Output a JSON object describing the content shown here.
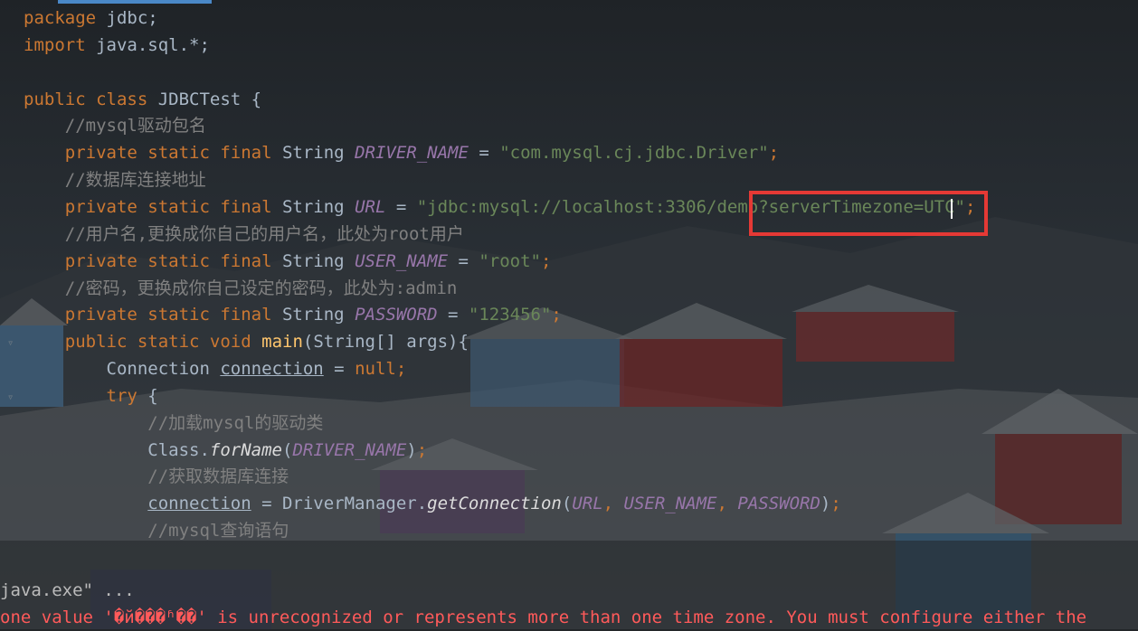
{
  "editor": {
    "lines": [
      [
        {
          "t": "package",
          "c": "kw"
        },
        {
          "t": " jdbc;",
          "c": "plain"
        }
      ],
      [
        {
          "t": "import",
          "c": "kw"
        },
        {
          "t": " java.sql.*;",
          "c": "plain"
        }
      ],
      [],
      [
        {
          "t": "public class",
          "c": "kw"
        },
        {
          "t": " JDBCTest {",
          "c": "plain"
        }
      ],
      [
        {
          "t": "    //mysql驱动包名",
          "c": "cmt"
        }
      ],
      [
        {
          "t": "    private static final",
          "c": "kw"
        },
        {
          "t": " String ",
          "c": "plain"
        },
        {
          "t": "DRIVER_NAME",
          "c": "const"
        },
        {
          "t": " = ",
          "c": "plain"
        },
        {
          "t": "\"com.mysql.cj.jdbc.Driver\"",
          "c": "str"
        },
        {
          "t": ";",
          "c": "kw"
        }
      ],
      [
        {
          "t": "    //数据库连接地址",
          "c": "cmt"
        }
      ],
      [
        {
          "t": "    private static final",
          "c": "kw"
        },
        {
          "t": " String ",
          "c": "plain"
        },
        {
          "t": "URL",
          "c": "const"
        },
        {
          "t": " = ",
          "c": "plain"
        },
        {
          "t": "\"jdbc:mysql://localhost:3306/demo?serverTimezone=UTC\"",
          "c": "str"
        },
        {
          "t": ";",
          "c": "kw"
        }
      ],
      [
        {
          "t": "    //用户名,更换成你自己的用户名，此处为root用户",
          "c": "cmt"
        }
      ],
      [
        {
          "t": "    private static final",
          "c": "kw"
        },
        {
          "t": " String ",
          "c": "plain"
        },
        {
          "t": "USER_NAME",
          "c": "const"
        },
        {
          "t": " = ",
          "c": "plain"
        },
        {
          "t": "\"root\"",
          "c": "str"
        },
        {
          "t": ";",
          "c": "kw"
        }
      ],
      [
        {
          "t": "    //密码，更换成你自己设定的密码，此处为:admin",
          "c": "cmt"
        }
      ],
      [
        {
          "t": "    private static final",
          "c": "kw"
        },
        {
          "t": " String ",
          "c": "plain"
        },
        {
          "t": "PASSWORD",
          "c": "const"
        },
        {
          "t": " = ",
          "c": "plain"
        },
        {
          "t": "\"123456\"",
          "c": "str"
        },
        {
          "t": ";",
          "c": "kw"
        }
      ],
      [
        {
          "t": "    public static void",
          "c": "kw"
        },
        {
          "t": " ",
          "c": "plain"
        },
        {
          "t": "main",
          "c": "fn"
        },
        {
          "t": "(String[] args){",
          "c": "plain"
        }
      ],
      [
        {
          "t": "        Connection ",
          "c": "plain"
        },
        {
          "t": "connection",
          "c": "local"
        },
        {
          "t": " = ",
          "c": "plain"
        },
        {
          "t": "null",
          "c": "kw"
        },
        {
          "t": ";",
          "c": "kw"
        }
      ],
      [
        {
          "t": "        try",
          "c": "kw"
        },
        {
          "t": " {",
          "c": "plain"
        }
      ],
      [
        {
          "t": "            //加载mysql的驱动类",
          "c": "cmt"
        }
      ],
      [
        {
          "t": "            Class.",
          "c": "plain"
        },
        {
          "t": "forName",
          "c": "call"
        },
        {
          "t": "(",
          "c": "plain"
        },
        {
          "t": "DRIVER_NAME",
          "c": "const"
        },
        {
          "t": ")",
          "c": "plain"
        },
        {
          "t": ";",
          "c": "kw"
        }
      ],
      [
        {
          "t": "            //获取数据库连接",
          "c": "cmt"
        }
      ],
      [
        {
          "t": "            ",
          "c": "plain"
        },
        {
          "t": "connection",
          "c": "local"
        },
        {
          "t": " = DriverManager.",
          "c": "plain"
        },
        {
          "t": "getConnection",
          "c": "call"
        },
        {
          "t": "(",
          "c": "plain"
        },
        {
          "t": "URL",
          "c": "const"
        },
        {
          "t": ", ",
          "c": "kw"
        },
        {
          "t": "USER_NAME",
          "c": "const"
        },
        {
          "t": ", ",
          "c": "kw"
        },
        {
          "t": "PASSWORD",
          "c": "const"
        },
        {
          "t": ")",
          "c": "plain"
        },
        {
          "t": ";",
          "c": "kw"
        }
      ],
      [
        {
          "t": "            //mysql查询语句",
          "c": "cmt"
        }
      ]
    ]
  },
  "console": {
    "command_line": "java.exe\" ...",
    "error_line": "one value '�й���ʱ��' is unrecognized or represents more than one time zone. You must configure either the"
  },
  "colors": {
    "keyword": "#cc7832",
    "string": "#6a8759",
    "comment": "#808080",
    "constant": "#9876aa",
    "highlight_box": "#e53935",
    "error_text": "#ff5a5a"
  }
}
